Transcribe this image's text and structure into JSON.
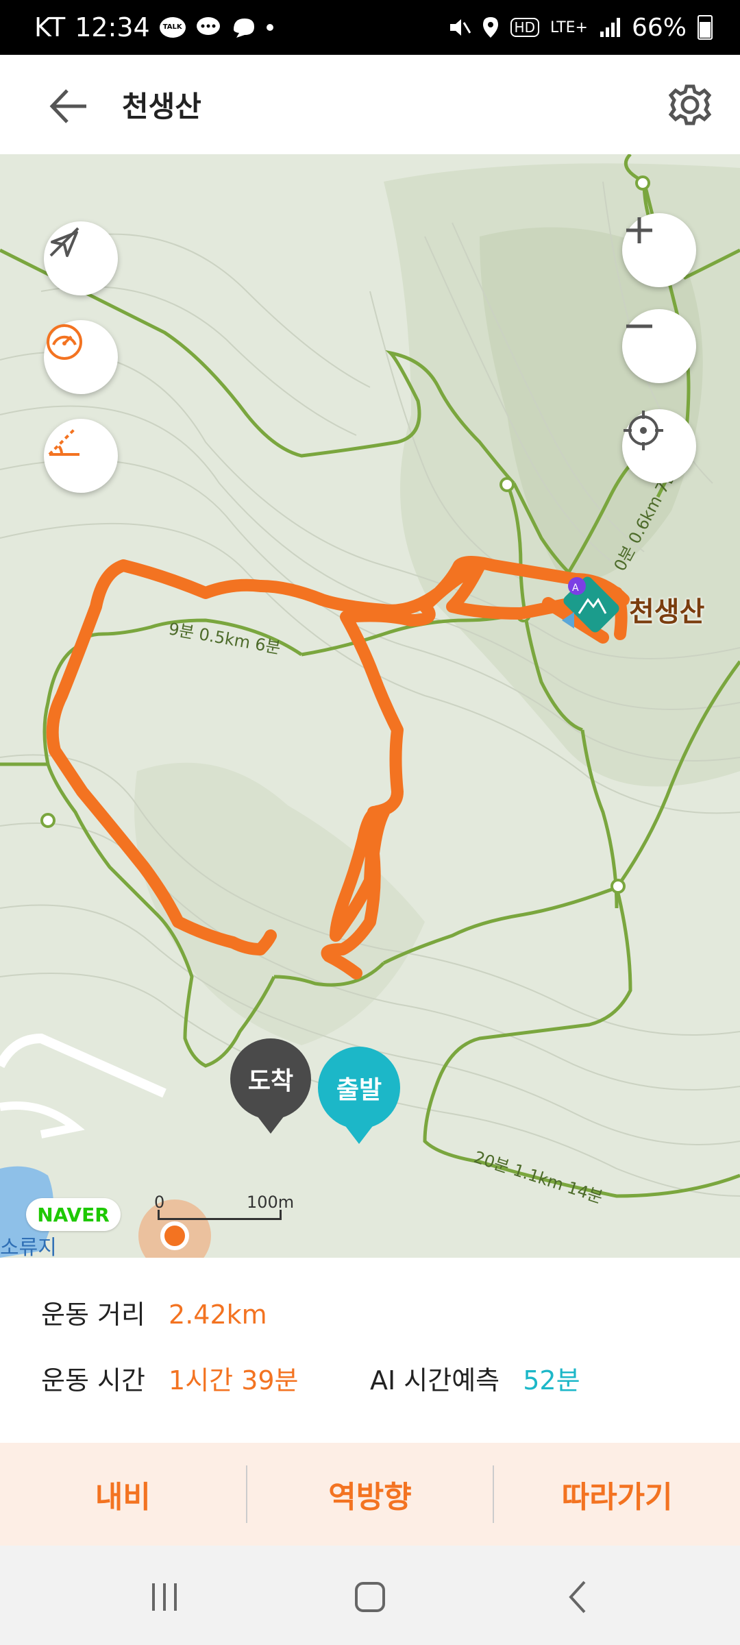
{
  "status_bar": {
    "carrier": "KT",
    "time": "12:34",
    "talk_badge": "TALK",
    "network": "LTE+",
    "hd": "HD",
    "battery": "66%"
  },
  "header": {
    "title": "천생산",
    "back_icon": "arrow-left-icon",
    "settings_icon": "gear-icon"
  },
  "map": {
    "peak_name": "천생산",
    "pins": {
      "arrival": "도착",
      "departure": "출발"
    },
    "scale": {
      "start": "0",
      "end": "100m"
    },
    "provider": "NAVER",
    "reservoir_label": "소류지",
    "trail_labels": [
      "9분 0.5km 6분",
      "0분 0.6km 7분",
      "20분 1.1km 14분"
    ],
    "buttons": {
      "compass": "compass-off-icon",
      "speed": "gauge-icon",
      "slope": "slope-icon",
      "zoom_in": "plus-icon",
      "zoom_out": "minus-icon",
      "locate": "crosshair-icon"
    },
    "colors": {
      "track": "#f37321",
      "trail": "#7aa63e",
      "departure": "#1cb7c8",
      "arrival": "#4a4a4a"
    }
  },
  "stats": {
    "distance_label": "운동 거리",
    "distance_value": "2.42km",
    "time_label": "운동 시간",
    "time_value": "1시간 39분",
    "ai_label": "AI 시간예측",
    "ai_value": "52분"
  },
  "actions": {
    "navi": "내비",
    "reverse": "역방향",
    "follow": "따라가기"
  },
  "nav_bar": {
    "recents": "recents-icon",
    "home": "home-icon",
    "back": "back-icon"
  }
}
